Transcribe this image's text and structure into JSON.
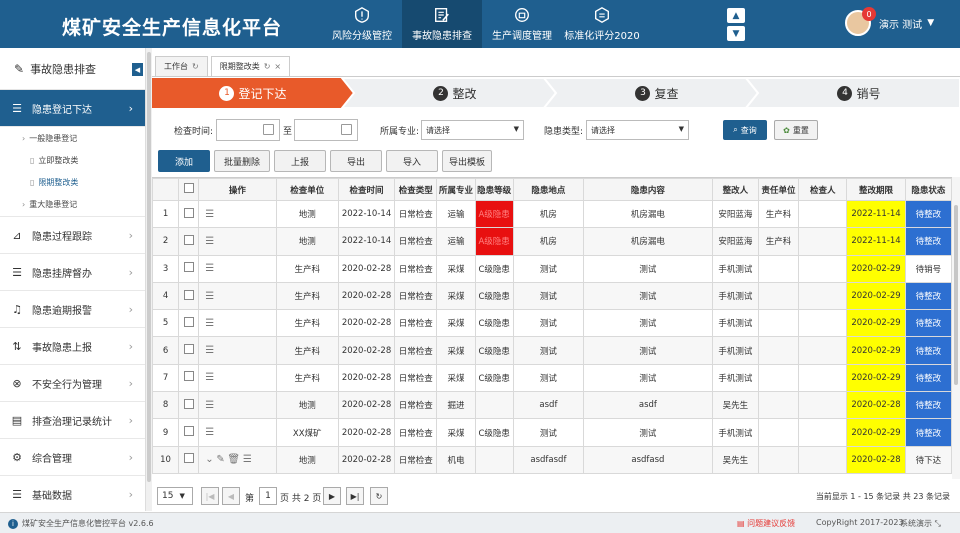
{
  "header": {
    "app_title": "煤矿安全生产信息化平台",
    "nav": [
      {
        "label": "风险分级管控",
        "icon": "risk-control-icon"
      },
      {
        "label": "事故隐患排查",
        "icon": "hazard-check-icon",
        "active": true
      },
      {
        "label": "生产调度管理",
        "icon": "dispatch-icon"
      },
      {
        "label": "标准化评分2020",
        "icon": "standard-score-icon"
      }
    ],
    "user": {
      "name": "演示 测试",
      "badge": "0"
    }
  },
  "sidebar": {
    "title": "事故隐患排查",
    "items": [
      {
        "label": "隐患登记下达",
        "icon": "list-icon",
        "active": true
      },
      {
        "label": "隐患过程跟踪",
        "icon": "trend-icon"
      },
      {
        "label": "隐患挂牌督办",
        "icon": "list-icon"
      },
      {
        "label": "隐患逾期报警",
        "icon": "bell-icon"
      },
      {
        "label": "事故隐患上报",
        "icon": "sort-icon"
      },
      {
        "label": "不安全行为管理",
        "icon": "close-circle-icon"
      },
      {
        "label": "排查治理记录统计",
        "icon": "document-icon"
      },
      {
        "label": "综合管理",
        "icon": "settings-icon"
      },
      {
        "label": "基础数据",
        "icon": "list-icon"
      }
    ],
    "sub": {
      "general": "一般隐患登记",
      "immediate": "立即整改类",
      "deadline": "限期整改类",
      "major": "重大隐患登记"
    }
  },
  "tabs": [
    {
      "label": "工作台",
      "active": false
    },
    {
      "label": "限期整改类",
      "active": true
    }
  ],
  "steps": [
    {
      "num": "1",
      "label": "登记下达",
      "active": true
    },
    {
      "num": "2",
      "label": "整改"
    },
    {
      "num": "3",
      "label": "复查"
    },
    {
      "num": "4",
      "label": "销号"
    }
  ],
  "filters": {
    "check_time_label": "检查时间:",
    "to_label": "至",
    "major_label": "所属专业:",
    "major_value": "请选择",
    "type_label": "隐患类型:",
    "type_value": "请选择",
    "query": "查询",
    "reset": "重置"
  },
  "toolbar": [
    "添加",
    "批量删除",
    "上报",
    "导出",
    "导入",
    "导出模板"
  ],
  "table": {
    "headers": [
      "",
      "",
      "操作",
      "检查单位",
      "检查时间",
      "检查类型",
      "所属专业",
      "隐患等级",
      "隐患地点",
      "隐患内容",
      "整改人",
      "责任单位",
      "检查人",
      "整改期限",
      "隐患状态"
    ],
    "rows": [
      {
        "no": "1",
        "unit": "地测",
        "time": "2022-10-14",
        "type": "日常检查",
        "major": "运输",
        "level": "A级隐患",
        "level_red": true,
        "place": "机房",
        "content": "机房漏电",
        "person": "安阳蓝海",
        "resp": "生产科",
        "inspector": "",
        "deadline": "2022-11-14",
        "status": "待整改",
        "status_blue": true
      },
      {
        "no": "2",
        "unit": "地测",
        "time": "2022-10-14",
        "type": "日常检查",
        "major": "运输",
        "level": "A级隐患",
        "level_red": true,
        "place": "机房",
        "content": "机房漏电",
        "person": "安阳蓝海",
        "resp": "生产科",
        "inspector": "",
        "deadline": "2022-11-14",
        "status": "待整改",
        "status_blue": true
      },
      {
        "no": "3",
        "unit": "生产科",
        "time": "2020-02-28",
        "type": "日常检查",
        "major": "采煤",
        "level": "C级隐患",
        "place": "测试",
        "content": "测试",
        "person": "手机测试",
        "resp": "",
        "inspector": "",
        "deadline": "2020-02-29",
        "status": "待销号",
        "status_blue": false
      },
      {
        "no": "4",
        "unit": "生产科",
        "time": "2020-02-28",
        "type": "日常检查",
        "major": "采煤",
        "level": "C级隐患",
        "place": "测试",
        "content": "测试",
        "person": "手机测试",
        "resp": "",
        "inspector": "",
        "deadline": "2020-02-29",
        "status": "待整改",
        "status_blue": true
      },
      {
        "no": "5",
        "unit": "生产科",
        "time": "2020-02-28",
        "type": "日常检查",
        "major": "采煤",
        "level": "C级隐患",
        "place": "测试",
        "content": "测试",
        "person": "手机测试",
        "resp": "",
        "inspector": "",
        "deadline": "2020-02-29",
        "status": "待整改",
        "status_blue": true
      },
      {
        "no": "6",
        "unit": "生产科",
        "time": "2020-02-28",
        "type": "日常检查",
        "major": "采煤",
        "level": "C级隐患",
        "place": "测试",
        "content": "测试",
        "person": "手机测试",
        "resp": "",
        "inspector": "",
        "deadline": "2020-02-29",
        "status": "待整改",
        "status_blue": true
      },
      {
        "no": "7",
        "unit": "生产科",
        "time": "2020-02-28",
        "type": "日常检查",
        "major": "采煤",
        "level": "C级隐患",
        "place": "测试",
        "content": "测试",
        "person": "手机测试",
        "resp": "",
        "inspector": "",
        "deadline": "2020-02-29",
        "status": "待整改",
        "status_blue": true
      },
      {
        "no": "8",
        "unit": "地测",
        "time": "2020-02-28",
        "type": "日常检查",
        "major": "掘进",
        "level": "",
        "place": "asdf",
        "content": "asdf",
        "person": "吴先生",
        "resp": "",
        "inspector": "",
        "deadline": "2020-02-28",
        "status": "待整改",
        "status_blue": true
      },
      {
        "no": "9",
        "unit": "XX煤矿",
        "time": "2020-02-28",
        "type": "日常检查",
        "major": "采煤",
        "level": "C级隐患",
        "place": "测试",
        "content": "测试",
        "person": "手机测试",
        "resp": "",
        "inspector": "",
        "deadline": "2020-02-29",
        "status": "待整改",
        "status_blue": true
      },
      {
        "no": "10",
        "unit": "地测",
        "time": "2020-02-28",
        "type": "日常检查",
        "major": "机电",
        "level": "",
        "place": "asdfasdf",
        "content": "asdfasd",
        "person": "吴先生",
        "resp": "",
        "inspector": "",
        "deadline": "2020-02-28",
        "status": "待下达",
        "status_blue": false,
        "editable": true
      }
    ]
  },
  "pager": {
    "page_size": "15",
    "page_label_pre": "第",
    "page_value": "1",
    "page_label_post": "页 共 2 页",
    "summary": "当前显示 1 - 15 条记录 共 23 条记录"
  },
  "footer": {
    "left": "煤矿安全生产信息化管控平台 v2.6.6",
    "feedback": "问题建议反馈",
    "copyright": "CopyRight 2017-2023",
    "system": "系统演示"
  },
  "colors": {
    "primary": "#1f5f8f",
    "accent_step": "#e85a2a",
    "red": "#e81010",
    "yellow": "#ffff00",
    "blue": "#2d6fd1"
  }
}
